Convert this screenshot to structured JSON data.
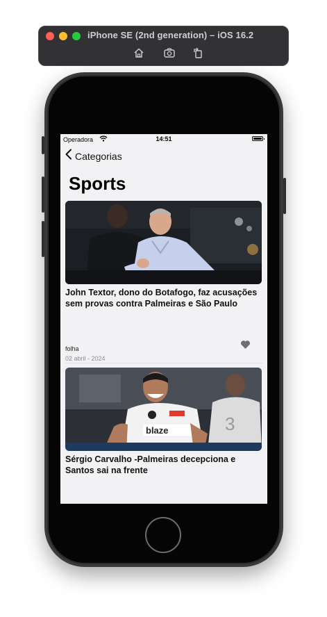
{
  "simulator": {
    "title": "iPhone SE (2nd generation) – iOS 16.2",
    "toolbar_icons": [
      "home-icon",
      "screenshot-icon",
      "rotate-icon"
    ]
  },
  "status_bar": {
    "carrier": "Operadora",
    "time": "14:51"
  },
  "nav": {
    "back_label": "Categorias"
  },
  "page": {
    "title": "Sports"
  },
  "articles": [
    {
      "title": "John Textor, dono do Botafogo, faz acusações sem provas contra Palmeiras e São Paulo",
      "source": "folha",
      "date": "02 abril - 2024"
    },
    {
      "title": "Sérgio Carvalho -Palmeiras decepciona e Santos sai na frente"
    }
  ],
  "colors": {
    "accent_heart": "#6e6e73",
    "screen_bg": "#f2f2f4"
  }
}
